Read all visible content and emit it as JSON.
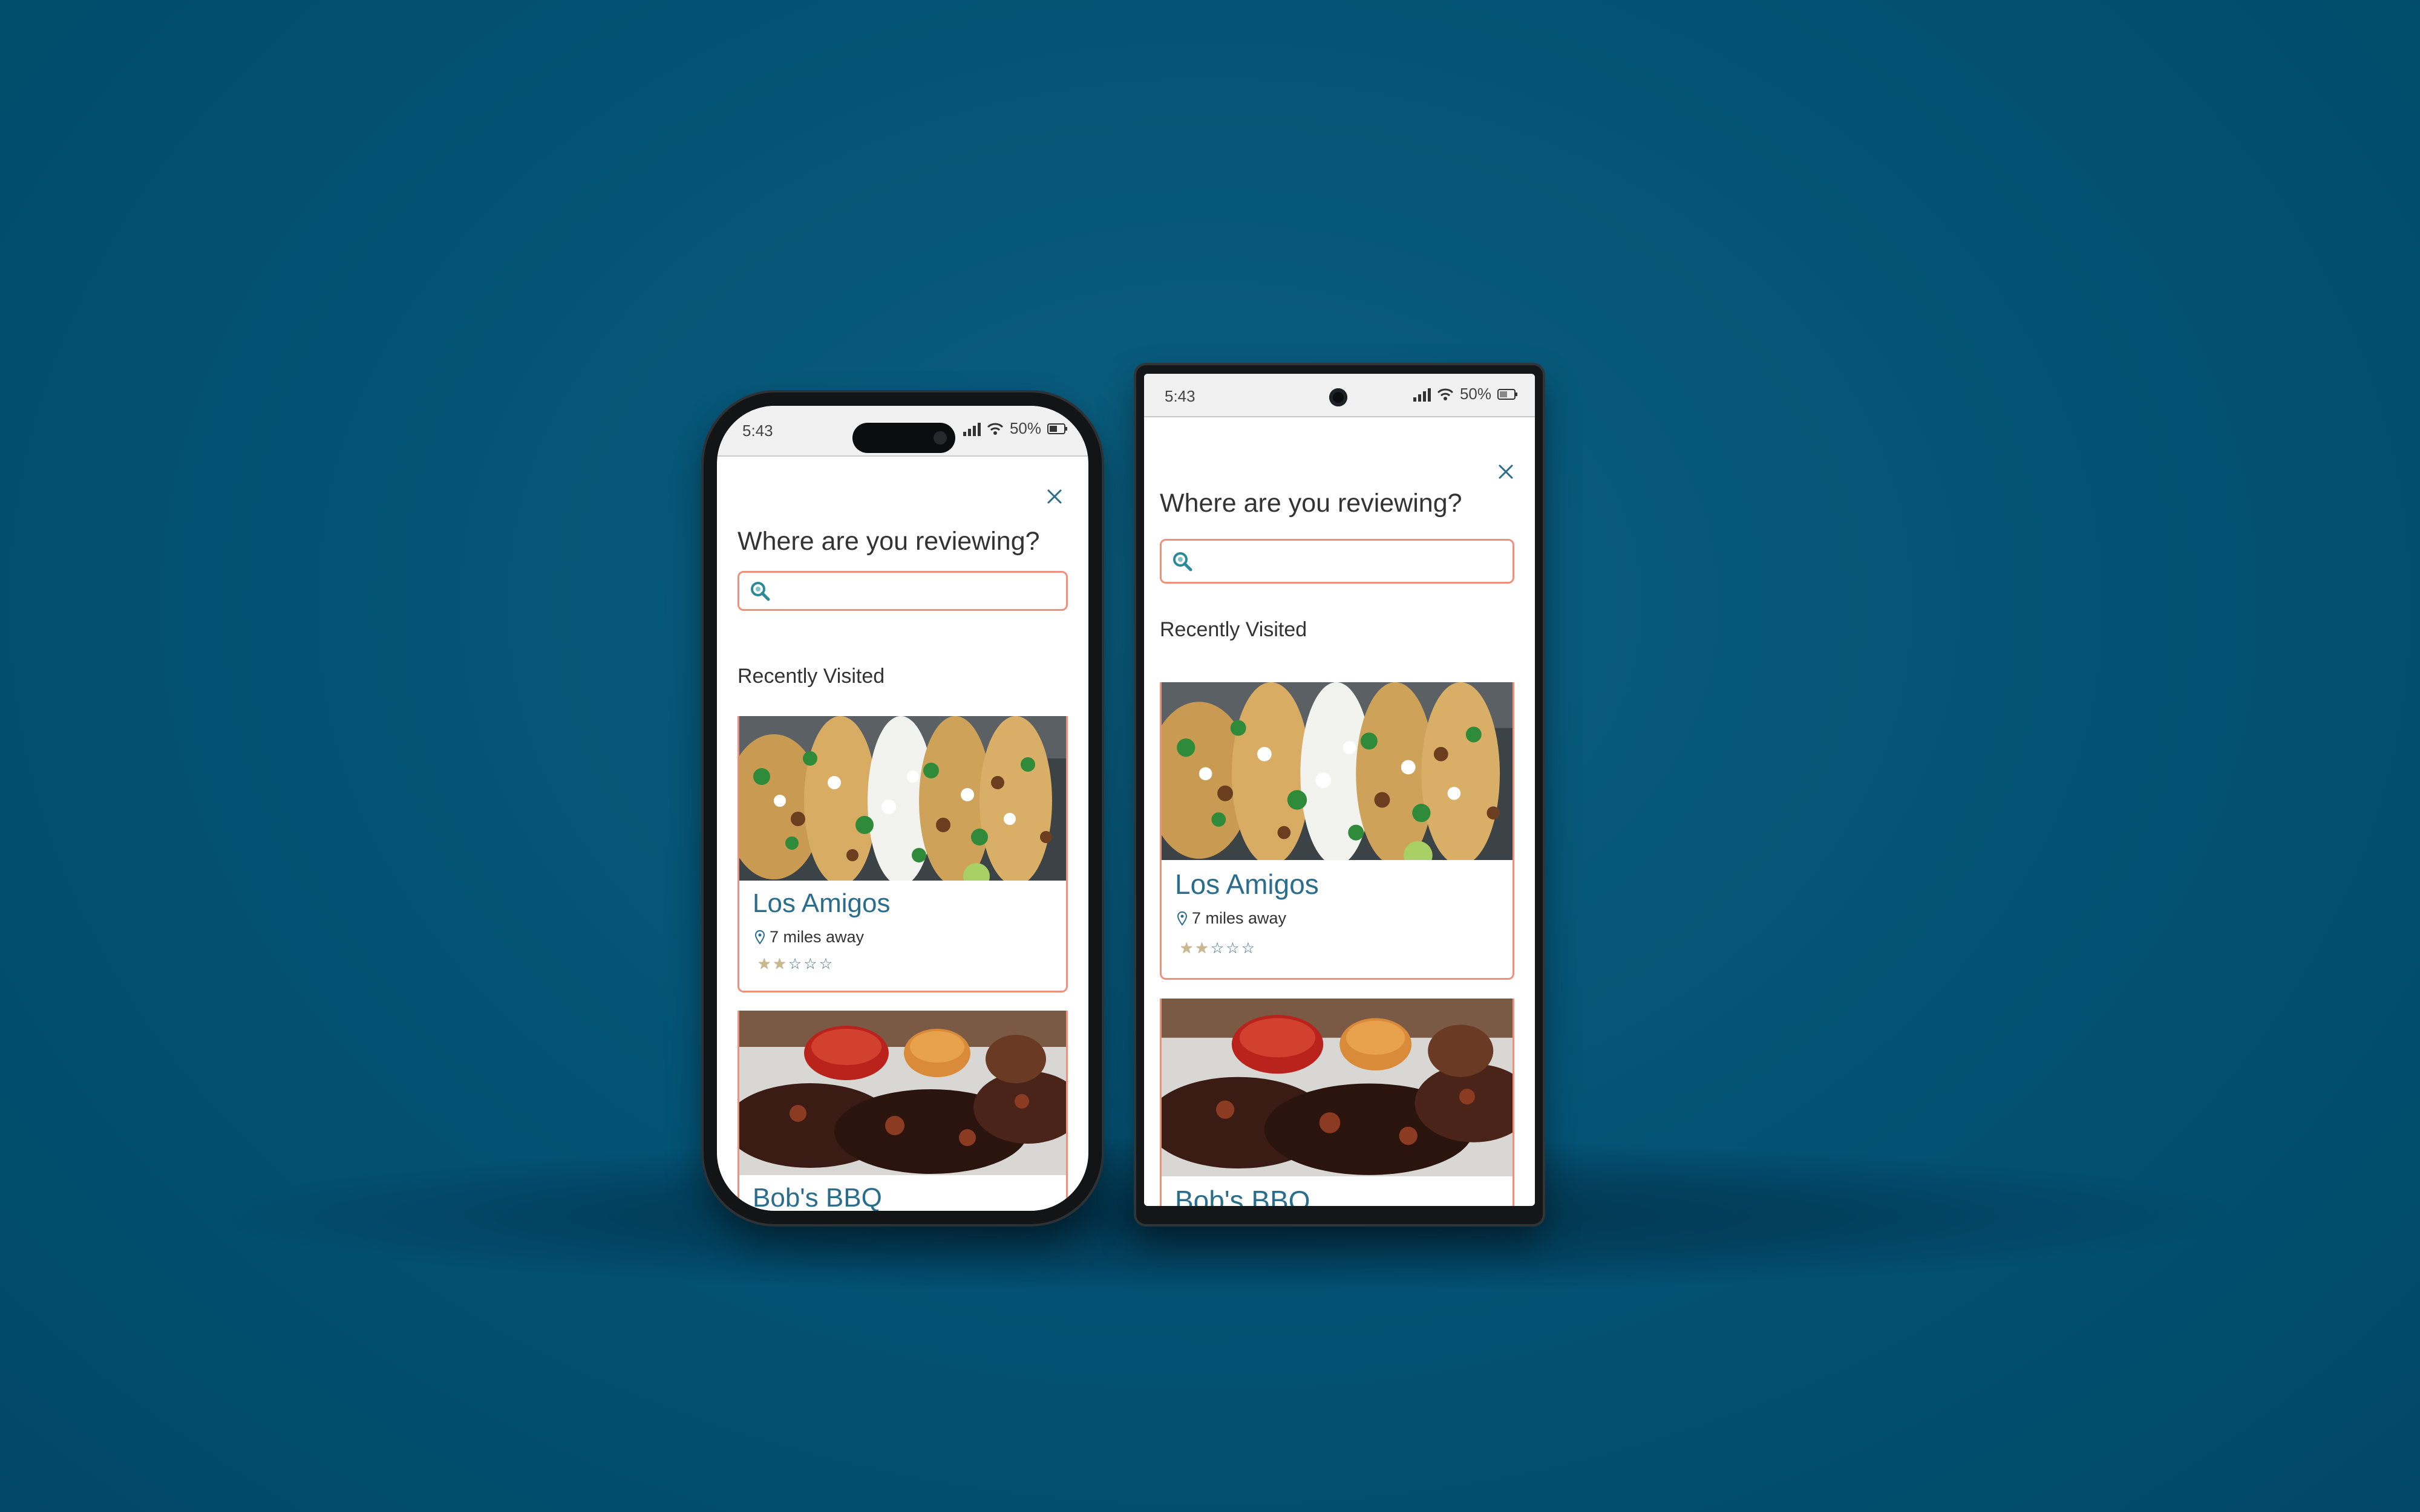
{
  "status": {
    "time": "5:43",
    "battery": "50%"
  },
  "modal": {
    "title": "Where are you reviewing?",
    "search_placeholder": "",
    "section_title": "Recently Visited"
  },
  "restaurants": [
    {
      "name": "Los Amigos",
      "distance": "7 miles away",
      "rating": 2,
      "max_rating": 5,
      "photo": "tacos"
    },
    {
      "name": "Bob's BBQ",
      "distance": "",
      "rating": null,
      "max_rating": 5,
      "photo": "bbq-brisket"
    }
  ],
  "colors": {
    "background": "#035275",
    "accent": "#f0907a",
    "link": "#2a6d8c",
    "icon": "#2a8a9a"
  },
  "icons": {
    "close": "close-icon",
    "search": "search-icon",
    "location": "location-pin-icon",
    "star": "star-icon"
  }
}
